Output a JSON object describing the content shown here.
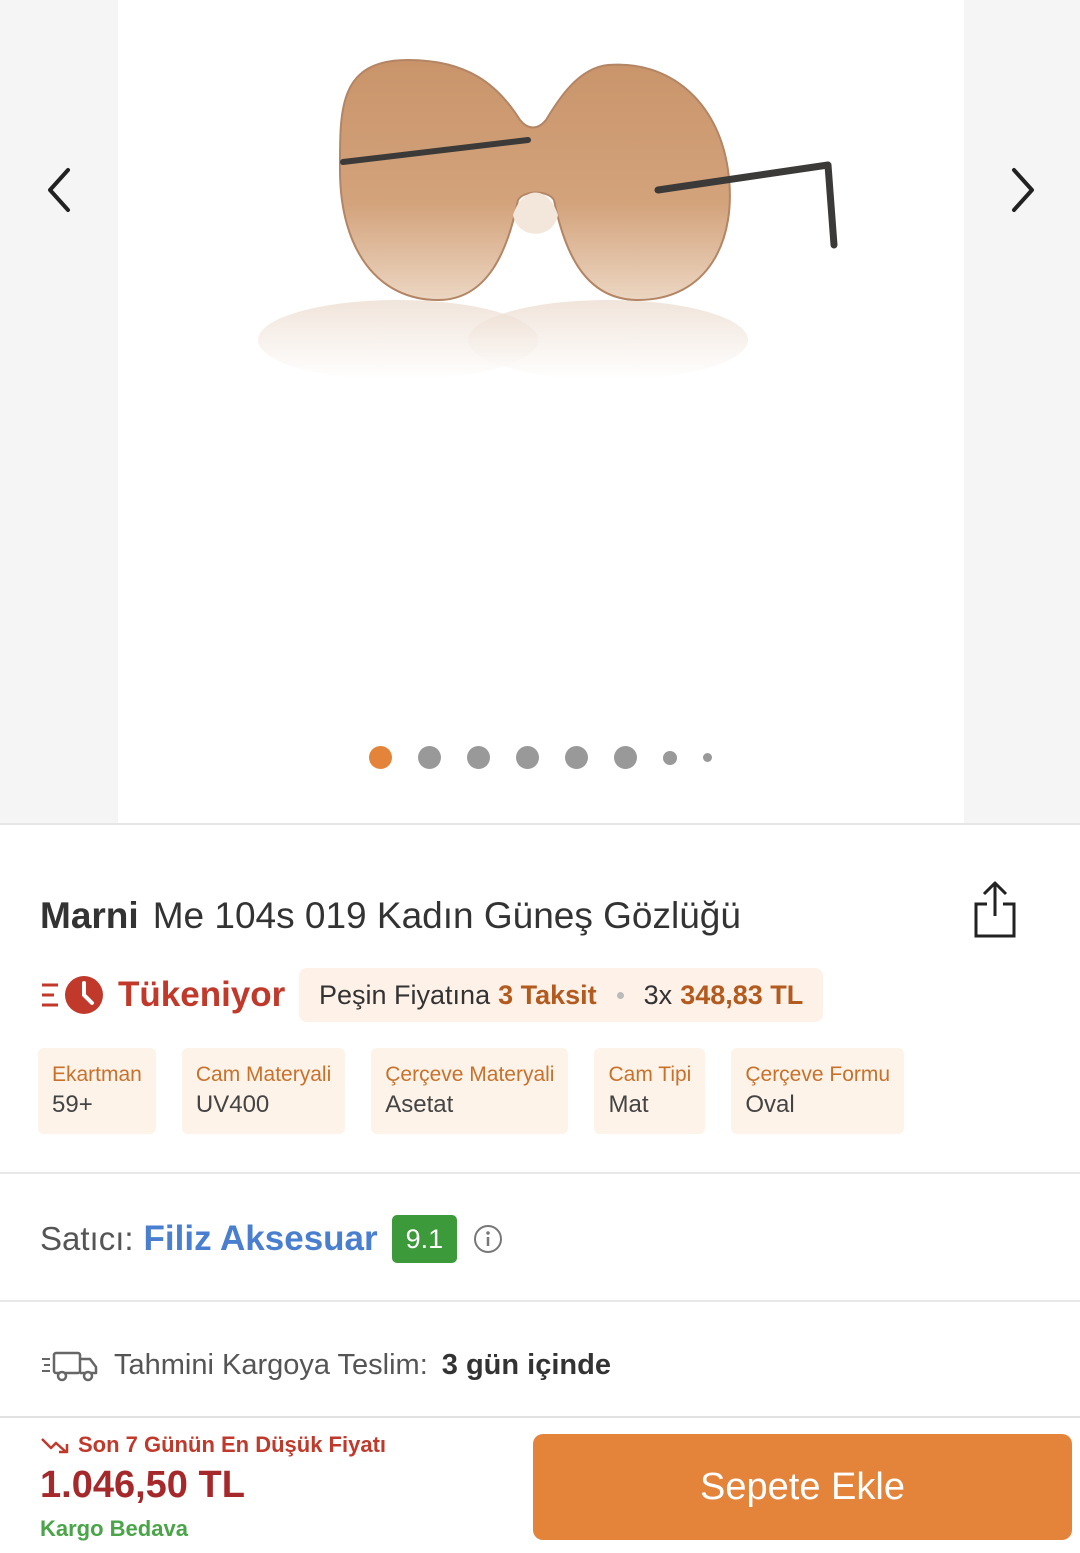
{
  "gallery": {
    "image_alt": "Marni Me 104s 019 sunglasses",
    "prev_icon": "chevron-left-icon",
    "next_icon": "chevron-right-icon",
    "dot_count": 8,
    "active_dot": 1
  },
  "product": {
    "brand": "Marni",
    "name": "Me 104s 019 Kadın Güneş Gözlüğü",
    "share_icon": "share-icon"
  },
  "stock": {
    "icon": "clock-fast-icon",
    "label": "Tükeniyor",
    "color": "#c0392b"
  },
  "installment": {
    "prefix": "Peşin Fiyatına",
    "highlight": "3 Taksit",
    "count_prefix": "3x",
    "amount": "348,83 TL"
  },
  "attributes": [
    {
      "label": "Ekartman",
      "value": "59+"
    },
    {
      "label": "Cam Materyali",
      "value": "UV400"
    },
    {
      "label": "Çerçeve Materyali",
      "value": "Asetat"
    },
    {
      "label": "Cam Tipi",
      "value": "Mat"
    },
    {
      "label": "Çerçeve Formu",
      "value": "Oval"
    }
  ],
  "seller": {
    "label": "Satıcı:",
    "name": "Filiz Aksesuar",
    "score": "9.1",
    "score_color": "#3c9a3a",
    "info_icon": "info-icon"
  },
  "delivery": {
    "icon": "truck-icon",
    "label": "Tahmini Kargoya Teslim:",
    "value": "3 gün içinde"
  },
  "bottom": {
    "lowest_icon": "trend-down-icon",
    "lowest_text": "Son 7 Günün En Düşük Fiyatı",
    "price": "1.046,50 TL",
    "shipping": "Kargo Bedava",
    "add_to_cart": "Sepete Ekle",
    "accent_color": "#e4843a"
  }
}
